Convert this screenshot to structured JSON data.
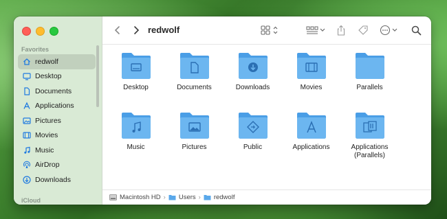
{
  "window": {
    "title": "redwolf"
  },
  "sidebar": {
    "favorites_label": "Favorites",
    "icloud_label": "iCloud",
    "items": [
      {
        "label": "redwolf",
        "icon": "house-icon",
        "selected": true
      },
      {
        "label": "Desktop",
        "icon": "desktop-icon",
        "selected": false
      },
      {
        "label": "Documents",
        "icon": "document-icon",
        "selected": false
      },
      {
        "label": "Applications",
        "icon": "applications-icon",
        "selected": false
      },
      {
        "label": "Pictures",
        "icon": "pictures-icon",
        "selected": false
      },
      {
        "label": "Movies",
        "icon": "movies-icon",
        "selected": false
      },
      {
        "label": "Music",
        "icon": "music-icon",
        "selected": false
      },
      {
        "label": "AirDrop",
        "icon": "airdrop-icon",
        "selected": false
      },
      {
        "label": "Downloads",
        "icon": "downloads-icon",
        "selected": false
      }
    ]
  },
  "folders": [
    {
      "label": "Desktop",
      "glyph": "desktop"
    },
    {
      "label": "Documents",
      "glyph": "document"
    },
    {
      "label": "Downloads",
      "glyph": "download"
    },
    {
      "label": "Movies",
      "glyph": "film"
    },
    {
      "label": "Parallels",
      "glyph": "none"
    },
    {
      "label": "Music",
      "glyph": "music"
    },
    {
      "label": "Pictures",
      "glyph": "picture"
    },
    {
      "label": "Public",
      "glyph": "public"
    },
    {
      "label": "Applications",
      "glyph": "apps"
    },
    {
      "label": "Applications (Parallels)",
      "glyph": "parallels-apps"
    }
  ],
  "pathbar": {
    "segments": [
      "Macintosh HD",
      "Users",
      "redwolf"
    ],
    "separator": "›"
  },
  "colors": {
    "accent": "#1f7ae0",
    "folder_front": "#6cb6f0",
    "folder_back": "#4a9ee6",
    "folder_glyph": "#2b6fb3"
  }
}
